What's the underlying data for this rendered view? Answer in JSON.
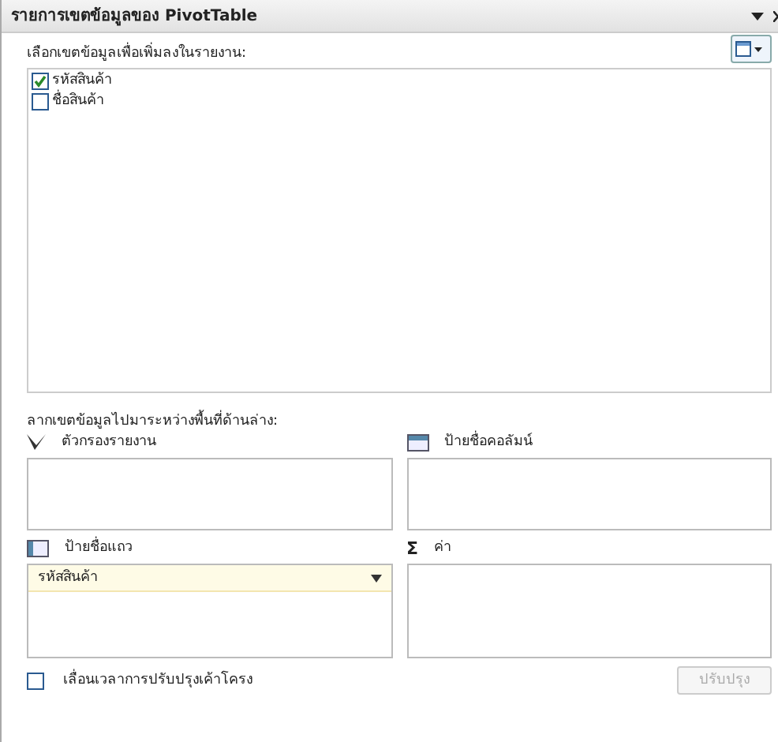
{
  "window": {
    "title": "รายการเขตข้อมูลของ PivotTable"
  },
  "field_list": {
    "label": "เลือกเขตข้อมูลเพื่อเพิ่มลงในรายงาน:",
    "fields": [
      {
        "name": "รหัสสินค้า",
        "checked": true
      },
      {
        "name": "ชื่อสินค้า",
        "checked": false
      }
    ]
  },
  "areas_label": "ลากเขตข้อมูลไปมาระหว่างพื้นที่ด้านล่าง:",
  "areas": [
    {
      "kind": "filter",
      "title": "ตัวกรองรายงาน"
    },
    {
      "kind": "columns",
      "title": "ป้ายชื่อคอลัมน์"
    },
    {
      "kind": "rows",
      "title": "ป้ายชื่อแถว",
      "items": [
        "รหัสสินค้า"
      ]
    },
    {
      "kind": "values",
      "icon": "Σ",
      "title": "ค่า"
    }
  ],
  "defer": {
    "label": "เลื่อนเวลาการปรับปรุงเค้าโครง",
    "checked": false
  },
  "update_button": {
    "label": "ปรับปรุง",
    "disabled": true
  }
}
